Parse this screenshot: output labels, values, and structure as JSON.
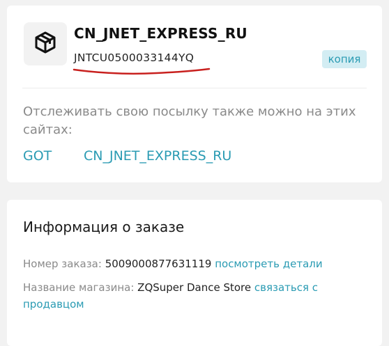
{
  "tracking": {
    "carrier": "CN_JNET_EXPRESS_RU",
    "tracking_number": "JNTCU0500033144YQ",
    "copy_label": "копия",
    "also_track_text": "Отслеживать свою посылку также можно на этих сайтах:",
    "sites": [
      "GOT",
      "CN_JNET_EXPRESS_RU"
    ],
    "icon": "package-icon",
    "underline_color": "#c8201e"
  },
  "order": {
    "title": "Информация о заказе",
    "order_number_label": "Номер заказа:",
    "order_number": "5009000877631119",
    "details_link": "посмотреть детали",
    "store_label": "Название магазина:",
    "store_name": "ZQSuper Dance Store",
    "contact_link": "связаться с продавцом"
  },
  "colors": {
    "accent": "#2a9bb3",
    "copy_bg": "#d3edf3",
    "muted_text": "#8a8a8a",
    "page_bg": "#f2f2f2"
  }
}
